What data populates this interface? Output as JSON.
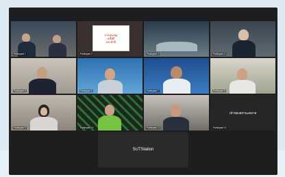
{
  "meeting": {
    "participants": [
      {
        "name": "Participant 1"
      },
      {
        "name": "Participant 2",
        "sign_lines": [
          "การประชุม",
          "ครั้งที่",
          "ประจำปี"
        ]
      },
      {
        "name": "Participant 3"
      },
      {
        "name": "Participant 4"
      },
      {
        "name": "Participant 5"
      },
      {
        "name": "Participant 6"
      },
      {
        "name": "Participant 7"
      },
      {
        "name": "Participant 8"
      },
      {
        "name": "Participant 9"
      },
      {
        "name": "Participant 10"
      },
      {
        "name": "Participant 11"
      },
      {
        "name": "Participant 12",
        "label": "เจ้าของสถานะคลาส"
      }
    ],
    "center_tile": {
      "label": "SUTStation"
    }
  },
  "colors": {
    "active_speaker": "#34c759",
    "window_bg": "#1d1d1d"
  }
}
